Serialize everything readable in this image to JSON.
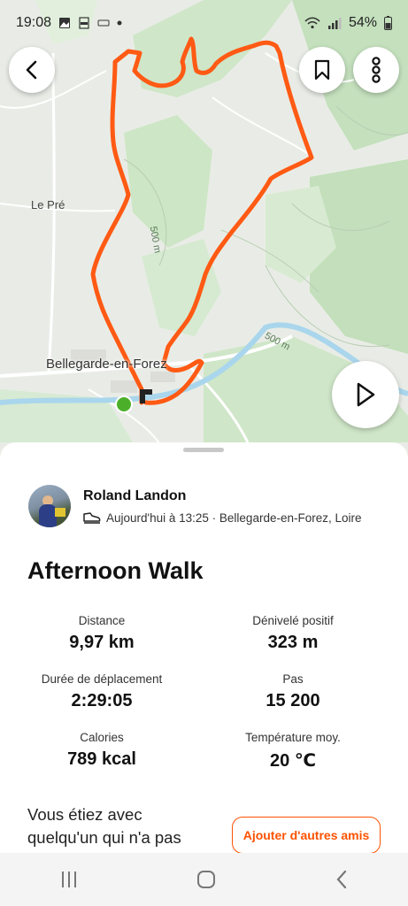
{
  "status_bar": {
    "time": "19:08",
    "battery": "54%"
  },
  "map": {
    "labels": {
      "place_1": "Le Pré",
      "town": "Bellegarde-en-Forez",
      "contour_1": "500 m",
      "contour_2": "500 m"
    },
    "route_color": "#ff5a14",
    "start_color": "#4caf2a"
  },
  "athlete": {
    "name": "Roland Landon",
    "meta": "Aujourd'hui à 13:25 · Bellegarde-en-Forez, Loire",
    "activity_icon": "walking-shoe-icon"
  },
  "activity": {
    "title": "Afternoon Walk"
  },
  "stats": [
    {
      "label": "Distance",
      "value": "9,97 km"
    },
    {
      "label": "Dénivelé positif",
      "value": "323 m"
    },
    {
      "label": "Durée de déplacement",
      "value": "2:29:05"
    },
    {
      "label": "Pas",
      "value": "15 200"
    },
    {
      "label": "Calories",
      "value": "789 kcal"
    },
    {
      "label": "Température moy.",
      "value": "20 ℃"
    }
  ],
  "together": {
    "text": "Vous étiez avec quelqu'un qui n'a pas",
    "button_label": "Ajouter d'autres amis",
    "accent": "#fc5200"
  }
}
